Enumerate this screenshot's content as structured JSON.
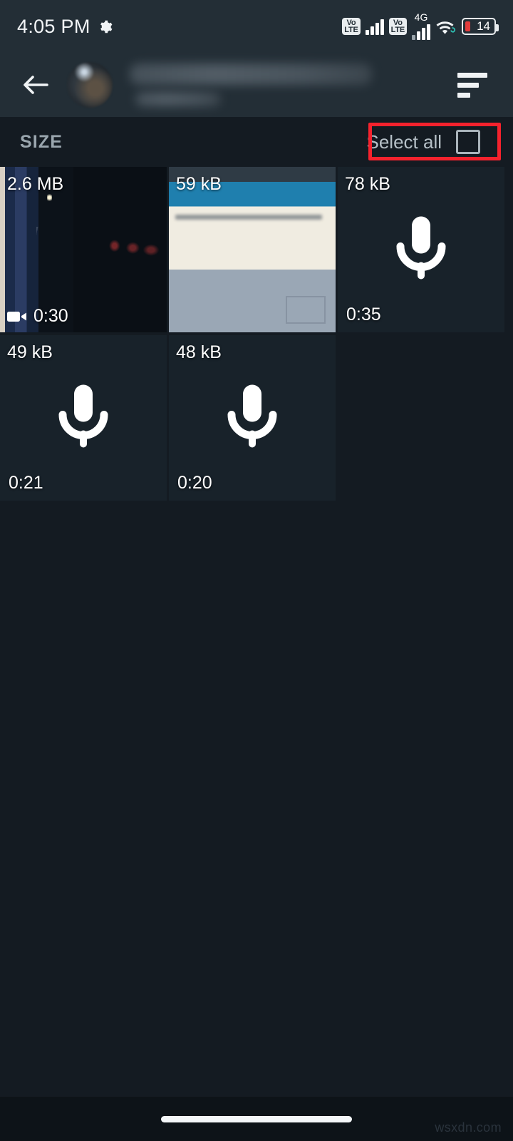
{
  "status_bar": {
    "time": "4:05 PM",
    "gear_icon": "gear-icon",
    "volte_top": "Vo",
    "volte_bottom": "LTE",
    "network_label": "4G",
    "wifi_icon": "wifi-icon",
    "battery_level": "14"
  },
  "app_bar": {
    "back_icon": "back-arrow-icon",
    "avatar": "contact-avatar",
    "title_redacted": "",
    "subtitle_redacted": "",
    "sort_icon": "sort-icon"
  },
  "section": {
    "title": "SIZE",
    "select_all_label": "Select all",
    "checkbox_checked": false,
    "highlight_color": "#f5222d"
  },
  "colors": {
    "app_bar_bg": "#232e36",
    "page_bg": "#141b22",
    "tile_bg": "#18222a",
    "nav_bg": "#0d1318",
    "accent_red": "#f5222d",
    "text_primary": "#ffffff",
    "text_secondary": "#9aa6ae"
  },
  "media_items": [
    {
      "size": "2.6 MB",
      "duration": "0:30",
      "type": "video",
      "icon": "video-camera-icon",
      "thumb": "thumb-train"
    },
    {
      "size": "59 kB",
      "duration": "",
      "type": "image",
      "icon": "",
      "thumb": "thumb-screen"
    },
    {
      "size": "78 kB",
      "duration": "0:35",
      "type": "audio",
      "icon": "microphone-icon",
      "thumb": ""
    },
    {
      "size": "49 kB",
      "duration": "0:21",
      "type": "audio",
      "icon": "microphone-icon",
      "thumb": ""
    },
    {
      "size": "48 kB",
      "duration": "0:20",
      "type": "audio",
      "icon": "microphone-icon",
      "thumb": ""
    }
  ],
  "nav_bar": {
    "home_pill": "home-indicator"
  },
  "watermark": {
    "text": "wsxdn.com"
  }
}
